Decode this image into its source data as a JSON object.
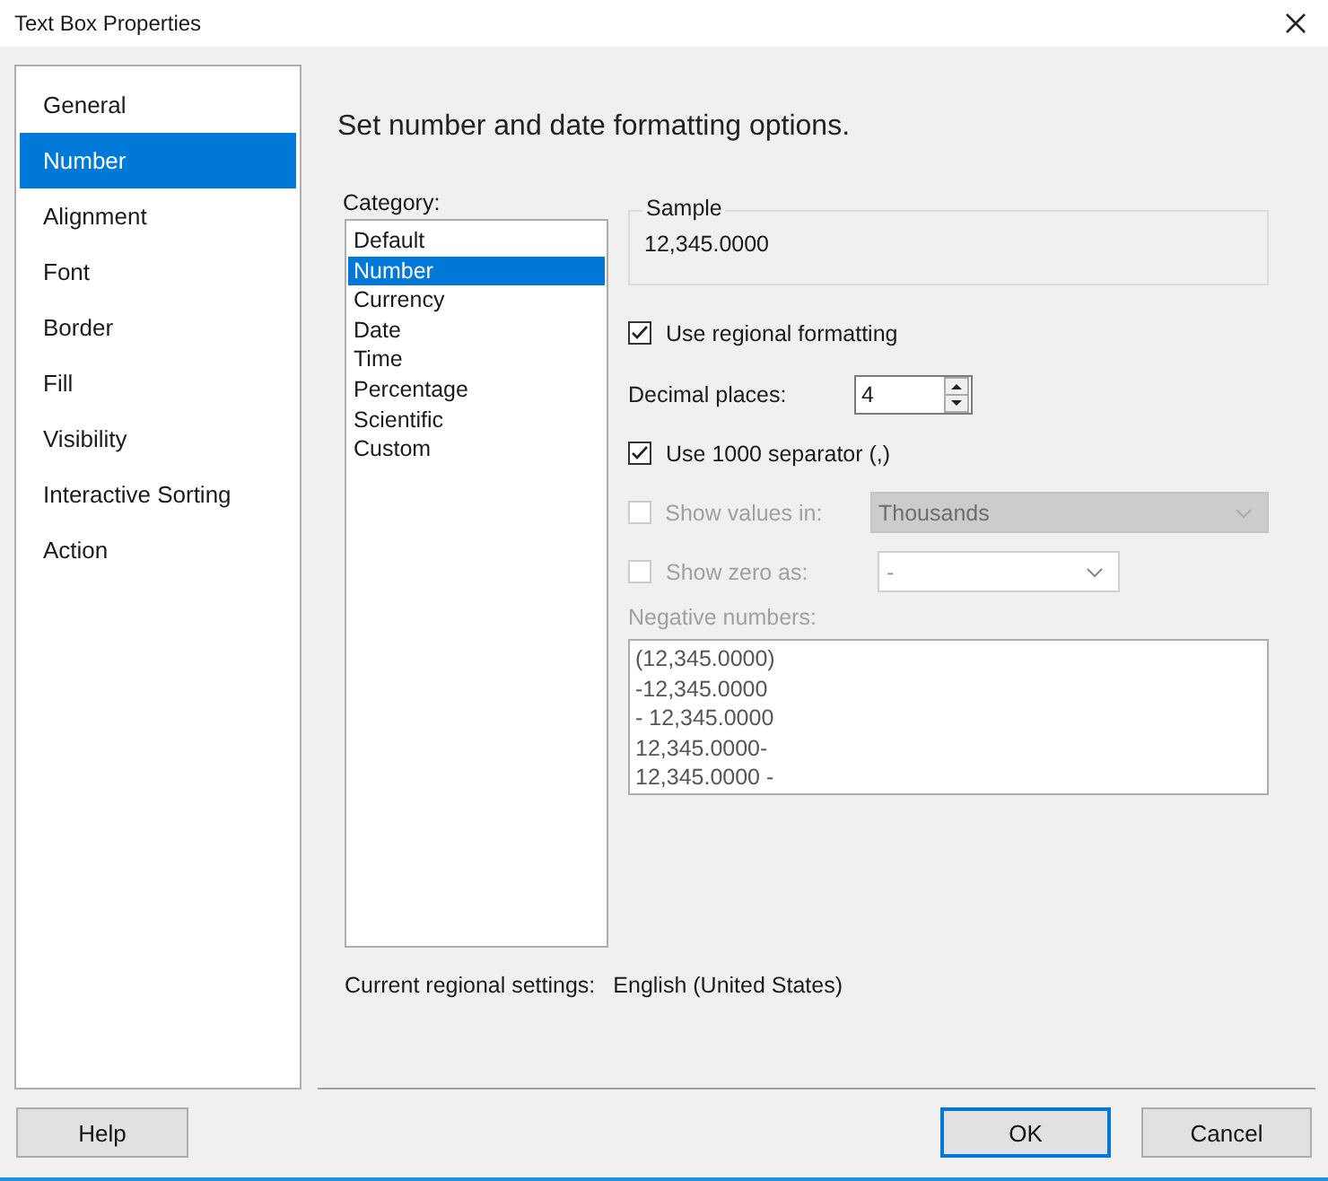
{
  "window": {
    "title": "Text Box Properties"
  },
  "sidebar": {
    "items": [
      {
        "label": "General",
        "selected": false
      },
      {
        "label": "Number",
        "selected": true
      },
      {
        "label": "Alignment",
        "selected": false
      },
      {
        "label": "Font",
        "selected": false
      },
      {
        "label": "Border",
        "selected": false
      },
      {
        "label": "Fill",
        "selected": false
      },
      {
        "label": "Visibility",
        "selected": false
      },
      {
        "label": "Interactive Sorting",
        "selected": false
      },
      {
        "label": "Action",
        "selected": false
      }
    ]
  },
  "heading": "Set number and date formatting options.",
  "category": {
    "label": "Category:",
    "items": [
      {
        "label": "Default",
        "selected": false
      },
      {
        "label": "Number",
        "selected": true
      },
      {
        "label": "Currency",
        "selected": false
      },
      {
        "label": "Date",
        "selected": false
      },
      {
        "label": "Time",
        "selected": false
      },
      {
        "label": "Percentage",
        "selected": false
      },
      {
        "label": "Scientific",
        "selected": false
      },
      {
        "label": "Custom",
        "selected": false
      }
    ]
  },
  "sample": {
    "label": "Sample",
    "value": "12,345.0000"
  },
  "use_regional_formatting": {
    "label": "Use regional formatting",
    "checked": true,
    "disabled": false
  },
  "decimal_places": {
    "label": "Decimal places:",
    "value": "4"
  },
  "use_separator": {
    "label": "Use 1000 separator (,)",
    "checked": true,
    "disabled": false
  },
  "show_values_in": {
    "label": "Show values in:",
    "checked": false,
    "disabled": true,
    "value": "Thousands"
  },
  "show_zero_as": {
    "label": "Show zero as:",
    "checked": false,
    "disabled": true,
    "value": "-"
  },
  "negative_numbers": {
    "label": "Negative numbers:",
    "disabled": true,
    "items": [
      "(12,345.0000)",
      "-12,345.0000",
      "- 12,345.0000",
      "12,345.0000-",
      "12,345.0000 -"
    ]
  },
  "regional_settings": {
    "label": "Current regional settings:",
    "value": "English (United States)"
  },
  "buttons": {
    "help": "Help",
    "ok": "OK",
    "cancel": "Cancel"
  }
}
